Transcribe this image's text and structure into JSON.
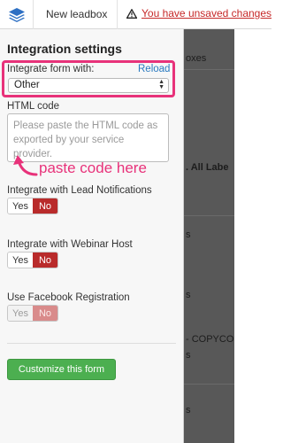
{
  "topbar": {
    "doc_title": "New leadbox",
    "warning_text": "You have unsaved changes",
    "logo_icon": "layers-stack-icon",
    "warning_icon": "warning-triangle-icon"
  },
  "panel": {
    "title": "Integration settings",
    "integrate": {
      "label": "Integrate form with:",
      "reload_label": "Reload",
      "selected": "Other",
      "highlight_color": "#e8327a"
    },
    "html_code": {
      "label": "HTML code",
      "placeholder": "Please paste the HTML code as exported by your service provider."
    },
    "annotation": "paste code here",
    "options": [
      {
        "label": "Integrate with Lead Notifications",
        "yes": "Yes",
        "no": "No",
        "selected": "No"
      },
      {
        "label": "Integrate with Webinar Host",
        "yes": "Yes",
        "no": "No",
        "selected": "No"
      },
      {
        "label": "Use Facebook Registration",
        "yes": "Yes",
        "no": "No",
        "selected": "No"
      }
    ],
    "customize_button": "Customize this form"
  },
  "background": {
    "fragments": [
      "oxes",
      ". All Labe",
      "s",
      "s",
      "- COPYCO",
      "s",
      "s"
    ]
  },
  "colors": {
    "accent_link": "#2a7ac0",
    "toggle_active": "#b92b2b",
    "button_green": "#4caf50",
    "warning_red": "#c62828"
  }
}
